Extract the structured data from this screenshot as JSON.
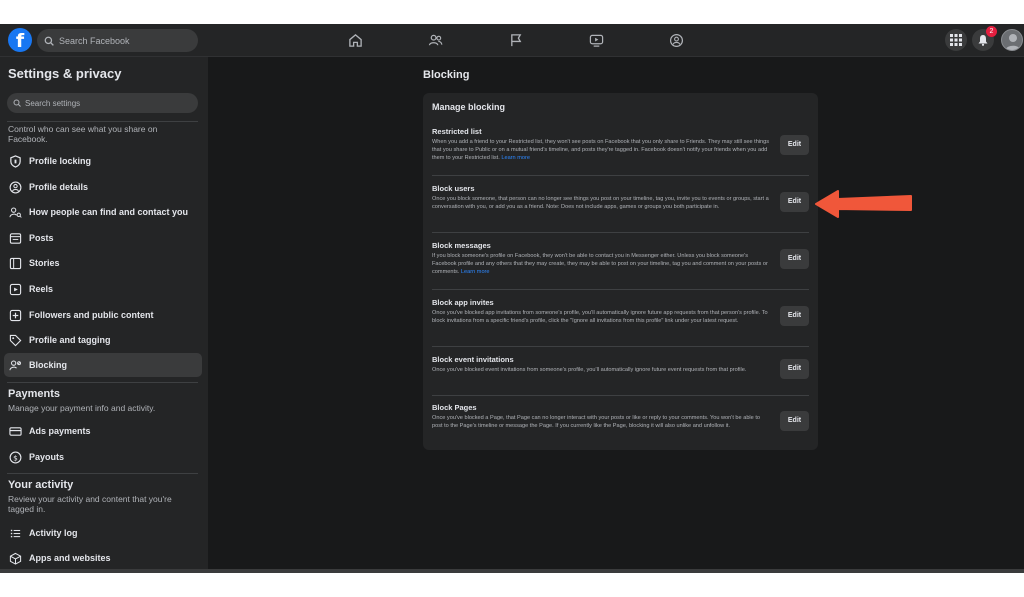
{
  "topbar": {
    "search_placeholder": "Search Facebook",
    "notification_count": "2",
    "accent_color": "#1877f2",
    "nav_icons": [
      "home-icon",
      "friends-icon",
      "flag-icon",
      "watch-icon",
      "groups-icon"
    ]
  },
  "sidebar": {
    "title": "Settings & privacy",
    "search_placeholder": "Search settings",
    "privacy_desc": "Control who can see what you share on Facebook.",
    "items": [
      {
        "label": "Profile locking",
        "icon": "shield-icon"
      },
      {
        "label": "Profile details",
        "icon": "user-circle-icon"
      },
      {
        "label": "How people can find and contact you",
        "icon": "person-search-icon"
      },
      {
        "label": "Posts",
        "icon": "posts-icon"
      },
      {
        "label": "Stories",
        "icon": "book-icon"
      },
      {
        "label": "Reels",
        "icon": "reels-icon"
      },
      {
        "label": "Followers and public content",
        "icon": "plus-square-icon"
      },
      {
        "label": "Profile and tagging",
        "icon": "tag-icon"
      },
      {
        "label": "Blocking",
        "icon": "block-user-icon"
      }
    ],
    "payments_title": "Payments",
    "payments_desc": "Manage your payment info and activity.",
    "payments_items": [
      {
        "label": "Ads payments",
        "icon": "card-icon"
      },
      {
        "label": "Payouts",
        "icon": "dollar-icon"
      }
    ],
    "activity_title": "Your activity",
    "activity_desc": "Review your activity and content that you're tagged in.",
    "activity_items": [
      {
        "label": "Activity log",
        "icon": "list-icon"
      },
      {
        "label": "Apps and websites",
        "icon": "cube-icon"
      }
    ]
  },
  "main": {
    "title": "Blocking",
    "card_title": "Manage blocking",
    "edit_label": "Edit",
    "learn_more": "Learn more",
    "sections": [
      {
        "title": "Restricted list",
        "desc": "When you add a friend to your Restricted list, they won't see posts on Facebook that you only share to Friends. They may still see things that you share to Public or on a mutual friend's timeline, and posts they're tagged in. Facebook doesn't notify your friends when you add them to your Restricted list."
      },
      {
        "title": "Block users",
        "desc": "Once you block someone, that person can no longer see things you post on your timeline, tag you, invite you to events or groups, start a conversation with you, or add you as a friend. Note: Does not include apps, games or groups you both participate in."
      },
      {
        "title": "Block messages",
        "desc": "If you block someone's profile on Facebook, they won't be able to contact you in Messenger either. Unless you block someone's Facebook profile and any others that they may create, they may be able to post on your timeline, tag you and comment on your posts or comments."
      },
      {
        "title": "Block app invites",
        "desc": "Once you've blocked app invitations from someone's profile, you'll automatically ignore future app requests from that person's profile. To block invitations from a specific friend's profile, click the \"Ignore all invitations from this profile\" link under your latest request."
      },
      {
        "title": "Block event invitations",
        "desc": "Once you've blocked event invitations from someone's profile, you'll automatically ignore future event requests from that profile."
      },
      {
        "title": "Block Pages",
        "desc": "Once you've blocked a Page, that Page can no longer interact with your posts or like or reply to your comments. You won't be able to post to the Page's timeline or message the Page. If you currently like the Page, blocking it will also unlike and unfollow it."
      }
    ]
  },
  "annotation": {
    "color": "#f0573a"
  }
}
